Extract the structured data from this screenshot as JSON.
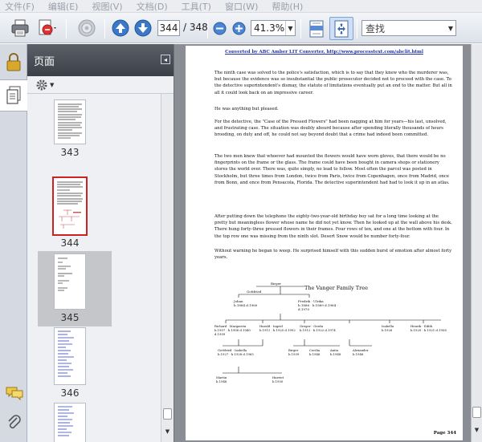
{
  "menu": {
    "items": [
      "文件(F)",
      "编辑(E)",
      "视图(V)",
      "文档(D)",
      "工具(T)",
      "窗口(W)",
      "帮助(H)"
    ]
  },
  "toolbar": {
    "page_current": "344",
    "page_total": "/ 348",
    "zoom": "41.3%",
    "find_placeholder": "查找",
    "icons": [
      "printer-icon",
      "create-pdf-icon",
      "collaborate-icon",
      "prev-page-icon",
      "next-page-icon",
      "zoom-out-icon",
      "zoom-in-icon",
      "fit-width-icon",
      "fit-page-icon"
    ]
  },
  "sidebar": {
    "rail_icons": [
      "lock-icon",
      "pages-icon",
      "comments-icon",
      "attachments-icon"
    ],
    "panel_title": "页面",
    "options_icon": "gear-icon",
    "thumbnails": [
      {
        "label": "343",
        "selected": false,
        "current": false
      },
      {
        "label": "344",
        "selected": true,
        "current": false
      },
      {
        "label": "345",
        "selected": false,
        "current": true
      },
      {
        "label": "346",
        "selected": false,
        "current": false
      },
      {
        "label": "",
        "selected": false,
        "current": false
      }
    ]
  },
  "document": {
    "header": "Converted by ABC Amber LIT Converter, http://www.processtext.com/abclit.html",
    "paragraphs": [
      "The ninth case was solved to the police's satisfaction, which is to say that they knew who the murderer was, but because the evidence was so insubstantial the public prosecutor decided not to proceed with the case. To the detective superintendent's dismay, the statute of limitations eventually put an end to the matter. But all in all it could look back on an impressive career.",
      "He was anything but pleased.",
      "For the detective, the \"Case of the Pressed Flowers\" had been nagging at him for years—his last, unsolved, and frustrating case. The situation was doubly absurd because after spending literally thousands of hours brooding, on duty and off, he could not say beyond doubt that a crime had indeed been committed.",
      "The two men knew that whoever had mounted the flowers would have worn gloves, that there would be no fingerprints on the frame or the glass. The frame could have been bought in camera shops or stationery stores the world over. There was, quite simply, no lead to follow. Most often the parcel was posted in Stockholm, but three times from London, twice from Paris, twice from Copenhagen, once from Madrid, once from Bonn, and once from Pensacola, Florida. The detective superintendent had had to look it up in an atlas.",
      "After putting down the telephone the eighty-two-year-old birthday boy sat for a long time looking at the pretty but meaningless flower whose name he did not yet know. Then he looked up at the wall above his desk. There hung forty-three pressed flowers in their frames. Four rows of ten, and one at the bottom with four. In the top row one was missing from the ninth slot. Desert Snow would be number forty-four.",
      "Without warning he began to weep. He surprised himself with this sudden burst of emotion after almost forty years."
    ],
    "tree": {
      "title": "The Vanger Family Tree",
      "gen1": [
        "Gottfried",
        "Birger"
      ],
      "gen2": [
        {
          "name": "Johan",
          "dates": "b.1884 d.1960"
        },
        {
          "name": "Fredrik · Ulrika",
          "dates": "b.1886 · b.1889 d.1964 · d.1970"
        }
      ],
      "gen3": [
        {
          "name": "Richard · Margareta",
          "dates": "b.1907 · b.1906 d.1940 · d.1959"
        },
        {
          "name": "Harald · Ingrid",
          "dates": "b.1911 · b.1925 d.1992"
        },
        {
          "name": "Greger · Gerda",
          "dates": "b.1912 · b.1922 d.1974"
        },
        {
          "name": "Isabella",
          "dates": "b.1926"
        },
        {
          "name": "Henrik · Edith",
          "dates": "b.1920 · b.1921 d.1958"
        }
      ],
      "gen4": [
        {
          "name": "Gottfried · Isabella",
          "dates": "b.1927 · b.1928 d.1965"
        },
        {
          "name": "Birger",
          "dates": "b.1939"
        },
        {
          "name": "Cecilia",
          "dates": "b.1946"
        },
        {
          "name": "Anita",
          "dates": "b.1948"
        },
        {
          "name": "Alexander",
          "dates": "b.1946"
        }
      ],
      "gen5": [
        {
          "name": "Martin",
          "dates": "b.1948"
        },
        {
          "name": "Harriet",
          "dates": "b.1950"
        }
      ]
    },
    "page_label": "Page 344"
  }
}
